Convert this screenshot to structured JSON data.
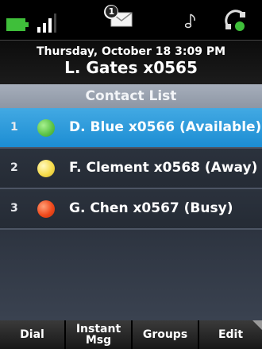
{
  "status_bar": {
    "battery_icon": "battery-icon",
    "signal_icon": "signal-strength-icon",
    "message_icon": "new-message-icon",
    "voicemail_count": "1",
    "music_icon": "music-note-icon",
    "headset_icon": "headset-icon"
  },
  "header": {
    "datetime": "Thursday, October 18 3:09 PM",
    "line": "L. Gates x0565"
  },
  "section": {
    "title": "Contact List"
  },
  "contacts": [
    {
      "index": "1",
      "label": "D. Blue x0566 (Available)",
      "presence_color": "#5fc64a",
      "selected": true
    },
    {
      "index": "2",
      "label": "F. Clement x0568 (Away)",
      "presence_color": "#f6dc4c",
      "selected": false
    },
    {
      "index": "3",
      "label": "G. Chen x0567 (Busy)",
      "presence_color": "#f04a1c",
      "selected": false
    }
  ],
  "softkeys": {
    "dial": "Dial",
    "instant_msg": "Instant\nMsg",
    "groups": "Groups",
    "edit": "Edit",
    "more_icon": "more-softkeys-arrow-icon"
  },
  "colors": {
    "selection": "#2a9ee0",
    "section_title_bg": "#98a1ae"
  }
}
